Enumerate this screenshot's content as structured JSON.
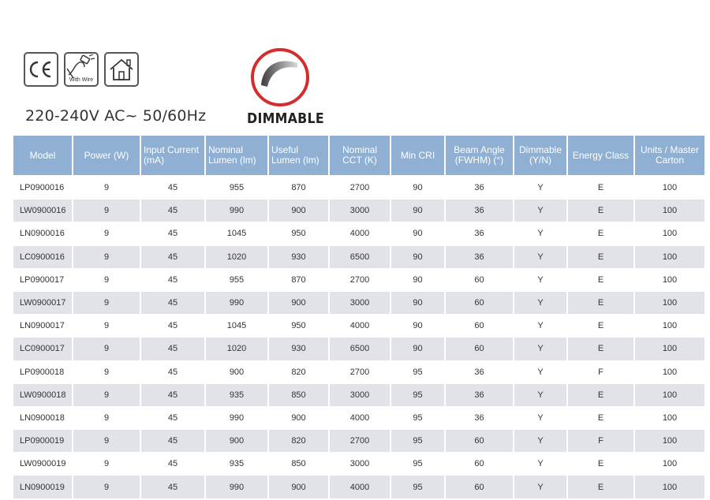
{
  "certifications": [
    {
      "name": "ce-mark",
      "label": "CE"
    },
    {
      "name": "with-wire",
      "label": "With Wire"
    },
    {
      "name": "indoor-use",
      "label": ""
    }
  ],
  "voltage": "220-240V AC~ 50/60Hz",
  "dimmable_label": "DIMMABLE",
  "colors": {
    "header_bg": "#8fb0d3",
    "row_alt": "#e1e3e8",
    "logo_red": "#d52c2c"
  },
  "table": {
    "headers": [
      "Model",
      "Power (W)",
      "Input Current (mA)",
      "Nominal Lumen (lm)",
      "Useful Lumen (lm)",
      "Nominal CCT (K)",
      "Min CRI",
      "Beam Angle (FWHM) (°)",
      "Dimmable (Y/N)",
      "Energy Class",
      "Units / Master Carton"
    ],
    "rows": [
      [
        "LP0900016",
        "9",
        "45",
        "955",
        "870",
        "2700",
        "90",
        "36",
        "Y",
        "E",
        "100"
      ],
      [
        "LW0900016",
        "9",
        "45",
        "990",
        "900",
        "3000",
        "90",
        "36",
        "Y",
        "E",
        "100"
      ],
      [
        "LN0900016",
        "9",
        "45",
        "1045",
        "950",
        "4000",
        "90",
        "36",
        "Y",
        "E",
        "100"
      ],
      [
        "LC0900016",
        "9",
        "45",
        "1020",
        "930",
        "6500",
        "90",
        "36",
        "Y",
        "E",
        "100"
      ],
      [
        "LP0900017",
        "9",
        "45",
        "955",
        "870",
        "2700",
        "90",
        "60",
        "Y",
        "E",
        "100"
      ],
      [
        "LW0900017",
        "9",
        "45",
        "990",
        "900",
        "3000",
        "90",
        "60",
        "Y",
        "E",
        "100"
      ],
      [
        "LN0900017",
        "9",
        "45",
        "1045",
        "950",
        "4000",
        "90",
        "60",
        "Y",
        "E",
        "100"
      ],
      [
        "LC0900017",
        "9",
        "45",
        "1020",
        "930",
        "6500",
        "90",
        "60",
        "Y",
        "E",
        "100"
      ],
      [
        "LP0900018",
        "9",
        "45",
        "900",
        "820",
        "2700",
        "95",
        "36",
        "Y",
        "F",
        "100"
      ],
      [
        "LW0900018",
        "9",
        "45",
        "935",
        "850",
        "3000",
        "95",
        "36",
        "Y",
        "E",
        "100"
      ],
      [
        "LN0900018",
        "9",
        "45",
        "990",
        "900",
        "4000",
        "95",
        "36",
        "Y",
        "E",
        "100"
      ],
      [
        "LP0900019",
        "9",
        "45",
        "900",
        "820",
        "2700",
        "95",
        "60",
        "Y",
        "F",
        "100"
      ],
      [
        "LW0900019",
        "9",
        "45",
        "935",
        "850",
        "3000",
        "95",
        "60",
        "Y",
        "E",
        "100"
      ],
      [
        "LN0900019",
        "9",
        "45",
        "990",
        "900",
        "4000",
        "95",
        "60",
        "Y",
        "E",
        "100"
      ]
    ]
  }
}
